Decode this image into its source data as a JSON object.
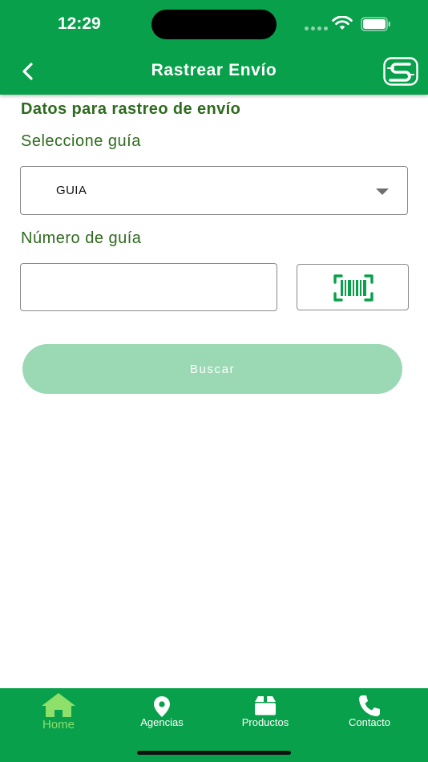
{
  "status_bar": {
    "time": "12:29"
  },
  "header": {
    "title": "Rastrear Envío"
  },
  "form": {
    "section_title": "Datos para rastreo de envío",
    "select_label": "Seleccione guía",
    "select_value": "GUIA",
    "number_label": "Número de guía",
    "number_value": "",
    "search_label": "Buscar"
  },
  "tabbar": {
    "items": [
      {
        "label": "Home",
        "icon": "home-icon",
        "active": true
      },
      {
        "label": "Agencias",
        "icon": "location-pin-icon"
      },
      {
        "label": "Productos",
        "icon": "box-icon"
      },
      {
        "label": "Contacto",
        "icon": "phone-icon"
      }
    ]
  },
  "colors": {
    "primary": "#08a04a",
    "text_green": "#2e6b1e",
    "button_disabled": "#9bd9b5",
    "active_tab": "#8ee06a"
  }
}
